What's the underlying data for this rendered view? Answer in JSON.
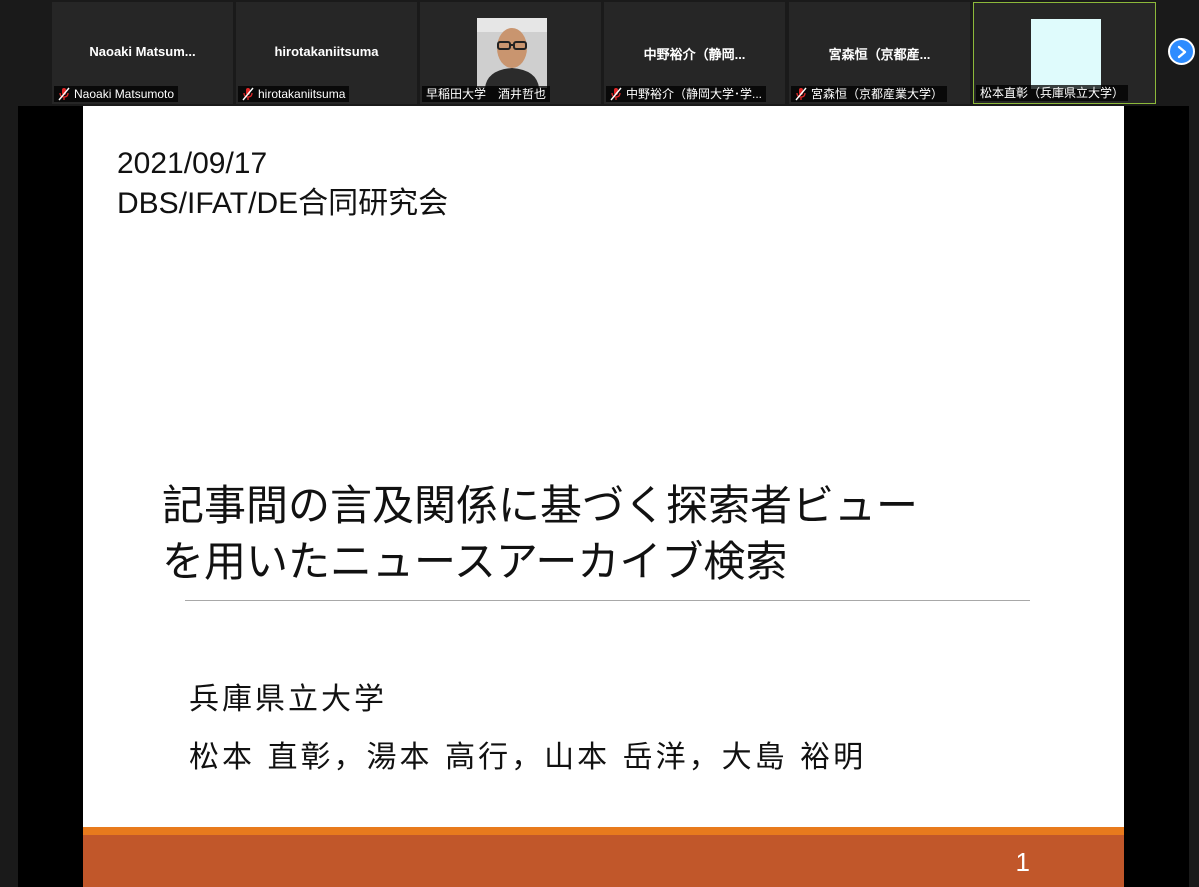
{
  "participants": [
    {
      "tile_name": "Naoaki  Matsum...",
      "label": "Naoaki Matsumoto",
      "muted": true
    },
    {
      "tile_name": "hirotakaniitsuma",
      "label": "hirotakaniitsuma",
      "muted": true
    },
    {
      "tile_name": "",
      "label": "早稲田大学　酒井哲也",
      "muted": false
    },
    {
      "tile_name": "中野裕介（静岡...",
      "label": "中野裕介（静岡大学･学...",
      "muted": true
    },
    {
      "tile_name": "宮森恒（京都産...",
      "label": "宮森恒（京都産業大学）",
      "muted": true
    },
    {
      "tile_name": "",
      "label": "松本直彰（兵庫県立大学）",
      "muted": false
    }
  ],
  "slide": {
    "date": "2021/09/17",
    "event": "DBS/IFAT/DE合同研究会",
    "title_line1": "記事間の言及関係に基づく探索者ビュー",
    "title_line2": "を用いたニュースアーカイブ検索",
    "affiliation": "兵庫県立大学",
    "authors": "松本 直彰，湯本 高行，山本 岳洋，大島 裕明",
    "page_number": "1"
  },
  "colors": {
    "accent_green": "#8cb83a",
    "next_button": "#2d8cff",
    "footer_orange": "#e87a1d",
    "footer_rust": "#c1572a"
  }
}
